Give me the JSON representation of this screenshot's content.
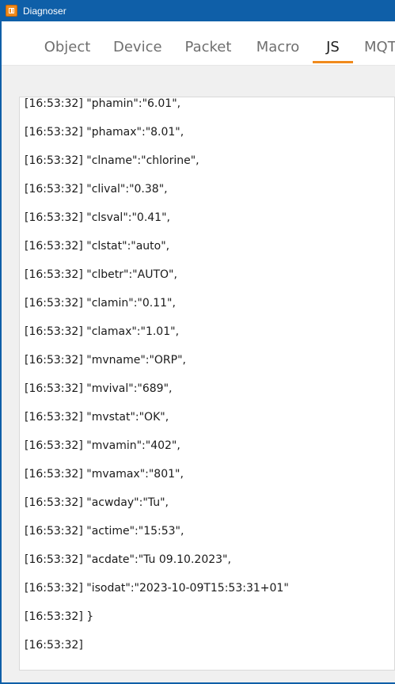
{
  "window": {
    "title": "Diagnoser",
    "title_icon": "app-logo-icon"
  },
  "tabs": [
    {
      "label": "Object",
      "active": false
    },
    {
      "label": "Device",
      "active": false
    },
    {
      "label": "Packet",
      "active": false
    },
    {
      "label": "Macro",
      "active": false
    },
    {
      "label": "JS",
      "active": true
    },
    {
      "label": "MQT",
      "active": false
    }
  ],
  "accent_color": "#f08a1c",
  "titlebar_color": "#0f5fa8",
  "log": [
    "[16:53:32] \"phamin\":\"6.01\",",
    "[16:53:32] \"phamax\":\"8.01\",",
    "[16:53:32] \"clname\":\"chlorine\",",
    "[16:53:32] \"clival\":\"0.38\",",
    "[16:53:32] \"clsval\":\"0.41\",",
    "[16:53:32] \"clstat\":\"auto\",",
    "[16:53:32] \"clbetr\":\"AUTO\",",
    "[16:53:32] \"clamin\":\"0.11\",",
    "[16:53:32] \"clamax\":\"1.01\",",
    "[16:53:32] \"mvname\":\"ORP\",",
    "[16:53:32] \"mvival\":\"689\",",
    "[16:53:32] \"mvstat\":\"OK\",",
    "[16:53:32] \"mvamin\":\"402\",",
    "[16:53:32] \"mvamax\":\"801\",",
    "[16:53:32] \"acwday\":\"Tu\",",
    "[16:53:32] \"actime\":\"15:53\",",
    "[16:53:32] \"acdate\":\"Tu 09.10.2023\",",
    "[16:53:32] \"isodat\":\"2023-10-09T15:53:31+01\"",
    "[16:53:32] }",
    "[16:53:32]"
  ]
}
